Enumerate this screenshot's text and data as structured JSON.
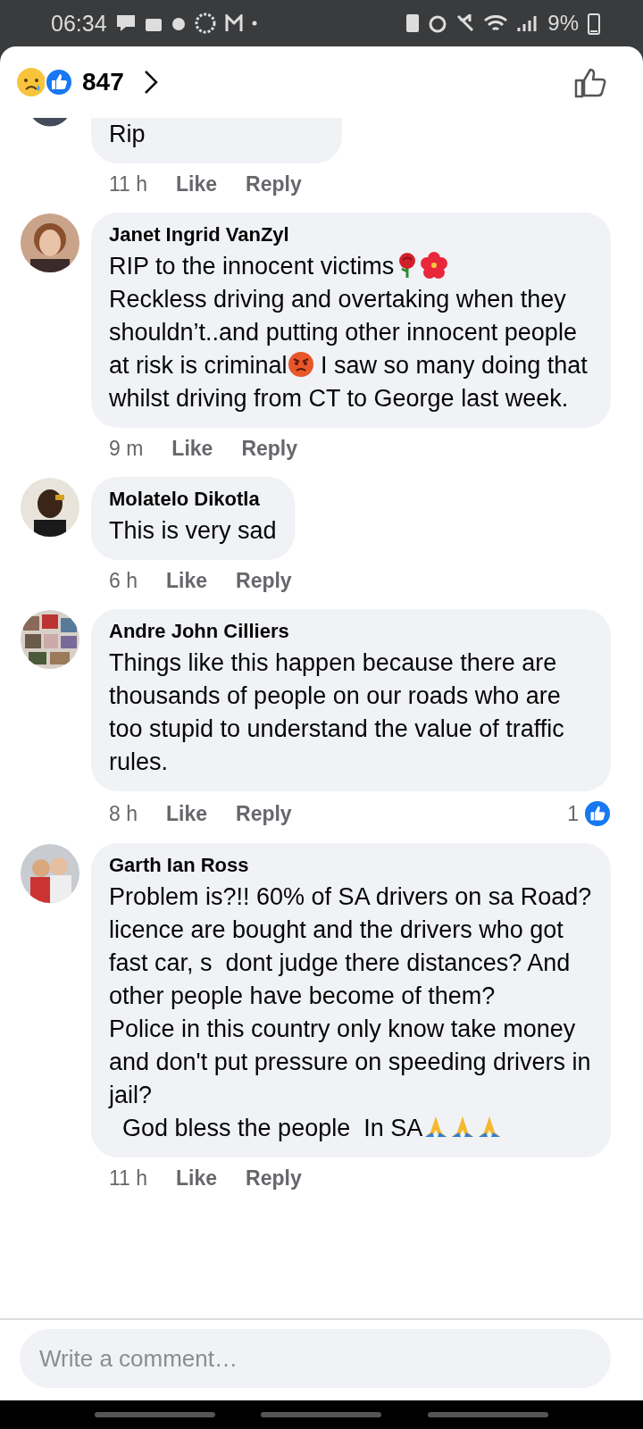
{
  "status_bar": {
    "time": "06:34",
    "battery": "9%"
  },
  "header": {
    "reaction_count": "847"
  },
  "comments": [
    {
      "body": [
        {
          "kind": "text",
          "text": "Rip"
        }
      ],
      "time": "11 h",
      "like": "Like",
      "reply": "Reply"
    },
    {
      "name": "Janet Ingrid VanZyl",
      "body": [
        {
          "kind": "text",
          "text": "RIP to the innocent victims"
        },
        {
          "kind": "rose"
        },
        {
          "kind": "hibiscus"
        },
        {
          "kind": "text",
          "text": "\nReckless driving and overtaking when they shouldn’t..and putting other innocent people at risk is criminal"
        },
        {
          "kind": "angry"
        },
        {
          "kind": "text",
          "text": " I saw so many doing that whilst driving from CT to George last week."
        }
      ],
      "time": "9 m",
      "like": "Like",
      "reply": "Reply"
    },
    {
      "name": "Molatelo Dikotla",
      "body": [
        {
          "kind": "text",
          "text": "This is very sad"
        }
      ],
      "time": "6 h",
      "like": "Like",
      "reply": "Reply"
    },
    {
      "name": "Andre John Cilliers",
      "body": [
        {
          "kind": "text",
          "text": "Things like this happen because there are thousands of people on our roads who are too stupid to understand the value of traffic rules."
        }
      ],
      "time": "8 h",
      "like": "Like",
      "reply": "Reply",
      "reactions": "1"
    },
    {
      "name": "Garth Ian Ross",
      "body": [
        {
          "kind": "text",
          "text": "Problem is?!! 60% of SA drivers on sa Road? licence are bought and the drivers who got fast car, s  dont judge there distances? And other people have become of them?\nPolice in this country only know take money and don't put pressure on speeding drivers in jail?\n  God bless the people  In SA"
        },
        {
          "kind": "pray"
        },
        {
          "kind": "pray"
        },
        {
          "kind": "pray"
        }
      ],
      "time": "11 h",
      "like": "Like",
      "reply": "Reply"
    }
  ],
  "composer": {
    "placeholder": "Write a comment…"
  }
}
